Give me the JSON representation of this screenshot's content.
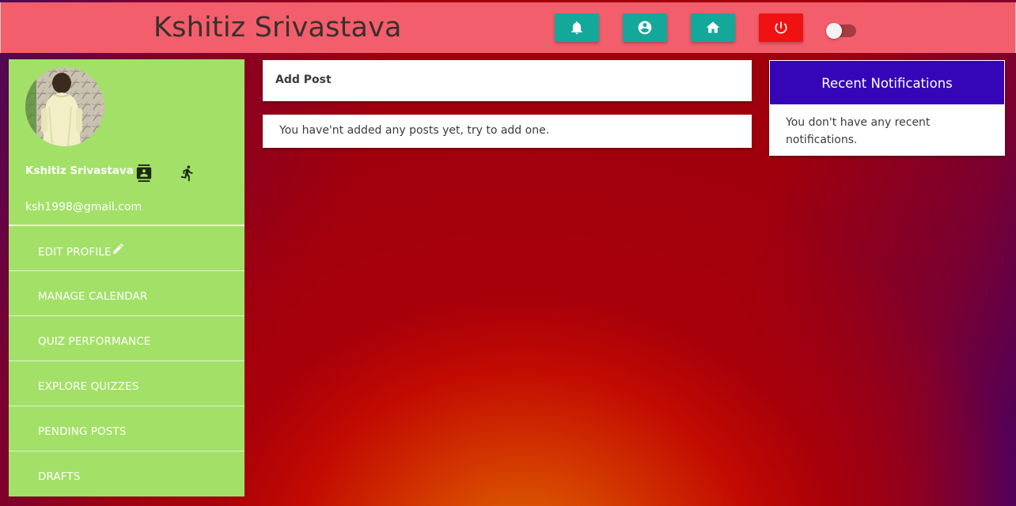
{
  "header": {
    "title": "Kshitiz Srivastava",
    "buttons": [
      {
        "name": "notifications",
        "icon": "bell-icon",
        "color": "#14a89a"
      },
      {
        "name": "profile",
        "icon": "account-circle-icon",
        "color": "#14a89a"
      },
      {
        "name": "home",
        "icon": "home-icon",
        "color": "#14a89a"
      },
      {
        "name": "logout",
        "icon": "power-icon",
        "color": "#f01212"
      }
    ],
    "toggle_on": false
  },
  "profile": {
    "name": "Kshitiz Srivastava",
    "email": "ksh1998@gmail.com",
    "icons": [
      "contact-card-icon",
      "running-person-icon"
    ]
  },
  "menu": [
    {
      "label": "EDIT PROFILE",
      "icon": "pencil-icon"
    },
    {
      "label": "MANAGE CALENDAR"
    },
    {
      "label": "QUIZ PERFORMANCE"
    },
    {
      "label": "EXPLORE QUIZZES"
    },
    {
      "label": "PENDING POSTS"
    },
    {
      "label": "DRAFTS"
    }
  ],
  "posts": {
    "add_label": "Add Post",
    "empty_message": "You have'nt added any posts yet, try to add one."
  },
  "notifications": {
    "title": "Recent Notifications",
    "empty_message": "You don't have any recent notifications."
  },
  "colors": {
    "topbar": "#f25e6b",
    "sidebar": "#a3e067",
    "notif_header": "#3506b8",
    "teal_button": "#14a89a",
    "power_button": "#f01212"
  }
}
